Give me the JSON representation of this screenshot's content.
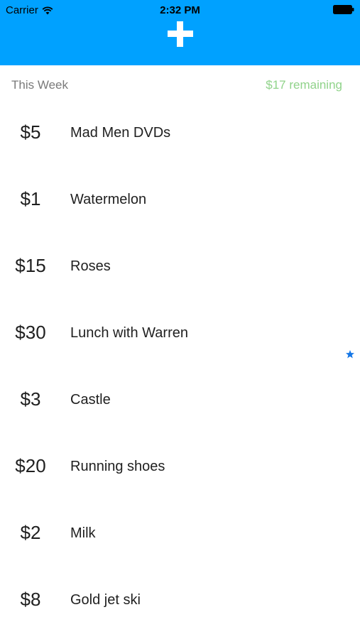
{
  "status_bar": {
    "carrier": "Carrier",
    "time": "2:32 PM",
    "wifi_icon": "wifi-icon",
    "battery_icon": "battery-icon"
  },
  "header": {
    "background": "#00a1ff",
    "add_icon": "plus-icon"
  },
  "summary": {
    "title": "This Week",
    "remaining": "$17 remaining",
    "remaining_color": "#90d38a"
  },
  "expenses": [
    {
      "amount": "$5",
      "name": "Mad Men DVDs"
    },
    {
      "amount": "$1",
      "name": "Watermelon"
    },
    {
      "amount": "$15",
      "name": "Roses"
    },
    {
      "amount": "$30",
      "name": "Lunch with Warren"
    },
    {
      "amount": "$3",
      "name": "Castle"
    },
    {
      "amount": "$20",
      "name": "Running shoes"
    },
    {
      "amount": "$2",
      "name": "Milk"
    },
    {
      "amount": "$8",
      "name": "Gold jet ski"
    }
  ],
  "star_icon": "star-icon",
  "star_color": "#1677e6"
}
